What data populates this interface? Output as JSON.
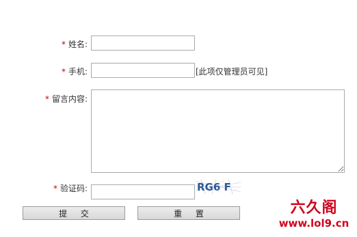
{
  "form": {
    "name": {
      "required_mark": "*",
      "label": "姓名:",
      "value": ""
    },
    "phone": {
      "required_mark": "*",
      "label": "手机:",
      "value": "",
      "note": "[此项仅管理员可见]"
    },
    "message": {
      "required_mark": "*",
      "label": "留言内容:",
      "value": ""
    },
    "captcha": {
      "required_mark": "*",
      "label": "验证码:",
      "value": "",
      "image_text": "RG6 F"
    },
    "submit_label": "提 交",
    "reset_label": "重 置"
  },
  "watermark": {
    "brand": "六久阁",
    "url": "www.lol9.cn"
  },
  "colors": {
    "required": "#cc0000",
    "watermark": "#d0021b",
    "captcha_text": "#2a5a9a"
  }
}
